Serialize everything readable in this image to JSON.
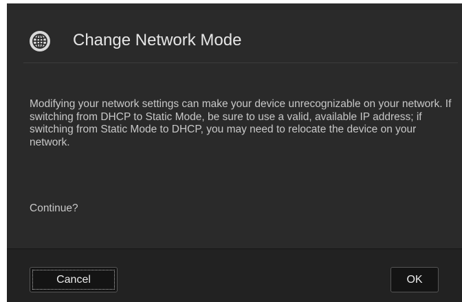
{
  "dialog": {
    "title": "Change Network Mode",
    "header_icon": "globe-icon",
    "message": "Modifying your network settings can make your device unrecognizable on your network. If switching from DHCP to Static Mode, be sure to use a valid, available IP address; if switching from Static Mode to DHCP, you may need to relocate the device on your network.",
    "prompt": "Continue?",
    "buttons": {
      "cancel_label": "Cancel",
      "ok_label": "OK"
    }
  },
  "colors": {
    "dialog_bg": "#2a2a2a",
    "footer_bg": "#222222",
    "button_bg": "#141414",
    "text": "#c8c8c8",
    "title_text": "#e6e6e6"
  }
}
